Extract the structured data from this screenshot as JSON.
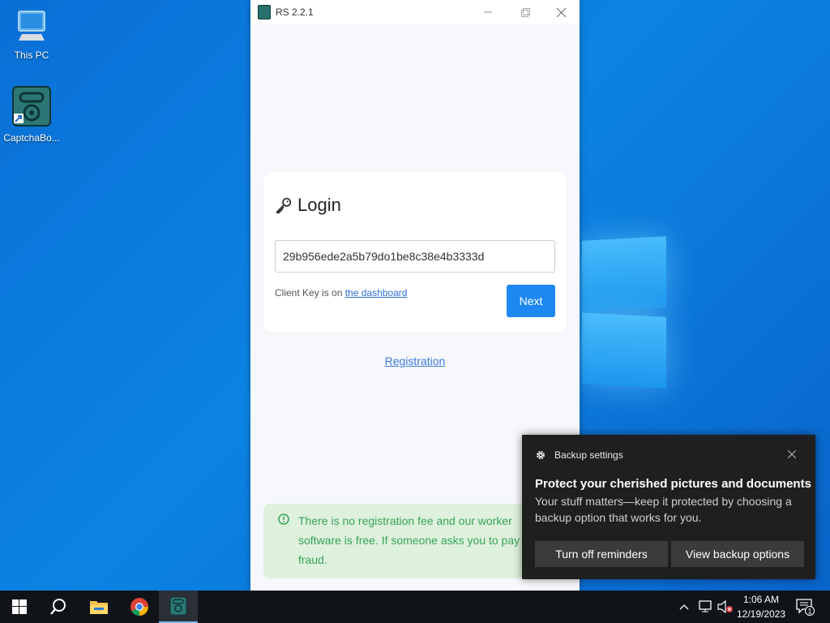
{
  "desktop": {
    "icons": [
      {
        "label": "This PC"
      },
      {
        "label": "CaptchaBo..."
      }
    ]
  },
  "app": {
    "title": "RS 2.2.1",
    "login_heading": "Login",
    "client_key_value": "29b956ede2a5b79do1be8c38e4b3333d",
    "hint_prefix": "Client Key is on ",
    "hint_link": "the dashboard",
    "next_label": "Next",
    "registration_label": "Registration",
    "notice_text": "There is no registration fee and our worker software is free. If someone asks you to pay a fraud."
  },
  "toast": {
    "header": "Backup settings",
    "title": "Protect your cherished pictures and documents",
    "body": "Your stuff matters—keep it protected by choosing a backup option that works for you.",
    "btn_off": "Turn off reminders",
    "btn_view": "View backup options"
  },
  "taskbar": {
    "time": "1:06 AM",
    "date": "12/19/2023",
    "notification_count": "1"
  },
  "colors": {
    "accent": "#1e88f2",
    "desktop": "#0a78dc",
    "notice_bg": "#ddf1dc",
    "notice_text": "#3aa35a"
  }
}
